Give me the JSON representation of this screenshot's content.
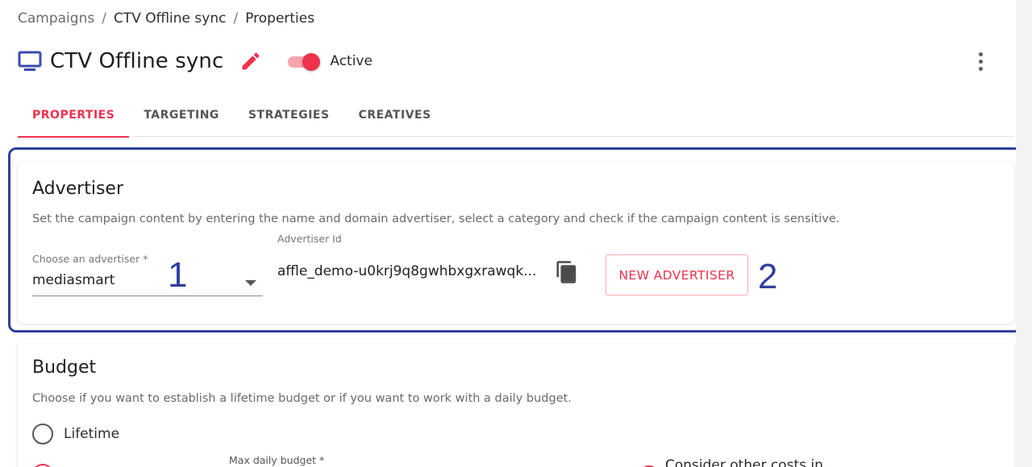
{
  "breadcrumb": {
    "items": [
      "Campaigns",
      "CTV Offline sync",
      "Properties"
    ],
    "separator": "/"
  },
  "header": {
    "title": "CTV Offline sync",
    "title_icon": "tv-icon",
    "edit_icon": "pencil-icon",
    "status_label": "Active",
    "status_on": true,
    "menu_icon": "more-vert-icon"
  },
  "tabs": [
    {
      "label": "PROPERTIES",
      "active": true
    },
    {
      "label": "TARGETING",
      "active": false
    },
    {
      "label": "STRATEGIES",
      "active": false
    },
    {
      "label": "CREATIVES",
      "active": false
    }
  ],
  "advertiser": {
    "title": "Advertiser",
    "description": "Set the campaign content by entering the name and domain advertiser, select a category and check if the campaign content is sensitive.",
    "select_label": "Choose an advertiser *",
    "select_value": "mediasmart",
    "id_label": "Advertiser Id",
    "id_value": "affle_demo-u0krj9q8gwhbxgxrawqk...",
    "copy_icon": "copy-icon",
    "new_button": "NEW ADVERTISER",
    "annotation_1": "1",
    "annotation_2": "2"
  },
  "budget": {
    "title": "Budget",
    "description": "Choose if you want to establish a lifetime budget or if you want to work with a daily budget.",
    "option_lifetime": "Lifetime",
    "max_daily_label": "Max daily budget *",
    "other_costs_label": "Consider other costs in"
  },
  "colors": {
    "accent": "#f0314d",
    "annotation": "#2f3f9e",
    "title_icon": "#3a4bb0"
  }
}
